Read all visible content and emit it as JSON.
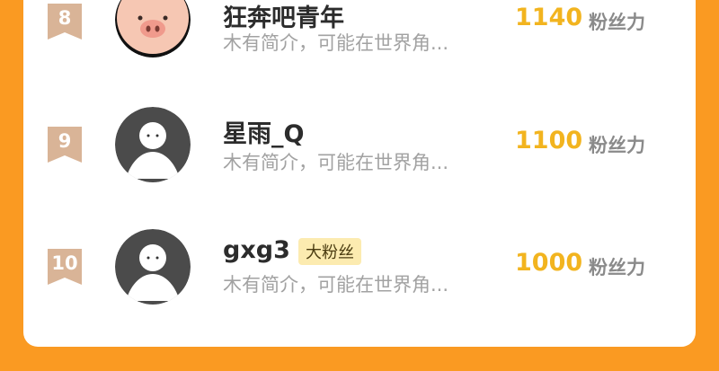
{
  "fans_unit": "粉丝力",
  "rows": [
    {
      "rank": "8",
      "name": "狂奔吧青年",
      "intro": "木有简介，可能在世界角...",
      "count": "1140",
      "avatar": "pig-avatar"
    },
    {
      "rank": "9",
      "name": "星雨_Q",
      "intro": "木有简介，可能在世界角...",
      "count": "1100",
      "avatar": "default-avatar"
    },
    {
      "rank": "10",
      "name": "gxg3",
      "badge": "大粉丝",
      "intro": "木有简介，可能在世界角...",
      "count": "1000",
      "avatar": "default-avatar"
    }
  ],
  "colors": {
    "background": "#fa9a22",
    "count": "#f2b41f",
    "rank_badge": "#d9b497",
    "badge_bg": "#fcebb0"
  }
}
